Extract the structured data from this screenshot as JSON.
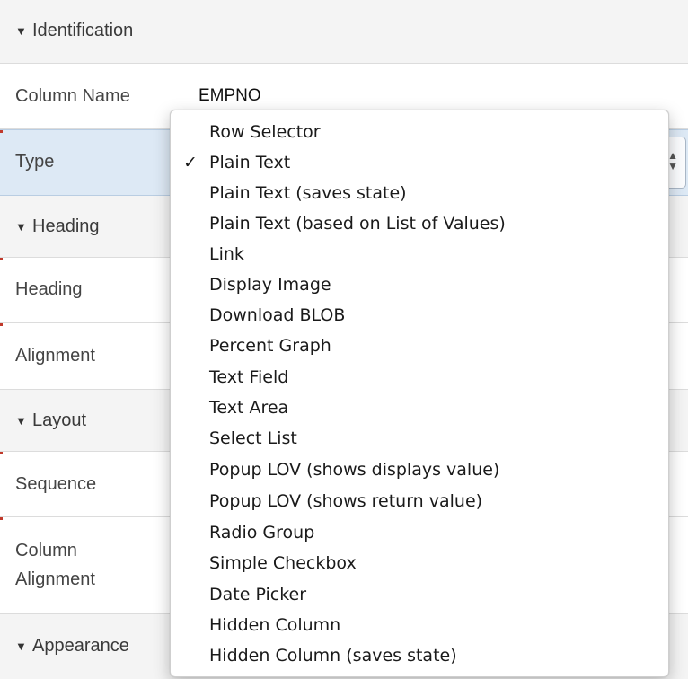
{
  "sections": {
    "identification": "Identification",
    "heading": "Heading",
    "layout": "Layout",
    "appearance": "Appearance"
  },
  "properties": {
    "column_name": {
      "label": "Column Name",
      "value": "EMPNO"
    },
    "type": {
      "label": "Type",
      "value": "Plain Text"
    },
    "heading": {
      "label": "Heading"
    },
    "alignment": {
      "label": "Alignment"
    },
    "sequence": {
      "label": "Sequence"
    },
    "column_alignment": {
      "label_line1": "Column",
      "label_line2": "Alignment"
    }
  },
  "icons": {
    "collapse": "triangle-down-icon",
    "select_arrows": "up-down-arrows-icon",
    "checkmark": "checkmark-icon"
  },
  "type_menu": {
    "selected": "Plain Text",
    "checkmark": "✓",
    "options": [
      "Row Selector",
      "Plain Text",
      "Plain Text (saves state)",
      "Plain Text (based on List of Values)",
      "Link",
      "Display Image",
      "Download BLOB",
      "Percent Graph",
      "Text Field",
      "Text Area",
      "Select List",
      "Popup LOV (shows displays value)",
      "Popup LOV (shows return value)",
      "Radio Group",
      "Simple Checkbox",
      "Date Picker",
      "Hidden Column",
      "Hidden Column (saves state)"
    ]
  },
  "colors": {
    "section_bg": "#f4f4f4",
    "selected_row_bg": "#dde9f5",
    "marker": "#c0392b"
  }
}
